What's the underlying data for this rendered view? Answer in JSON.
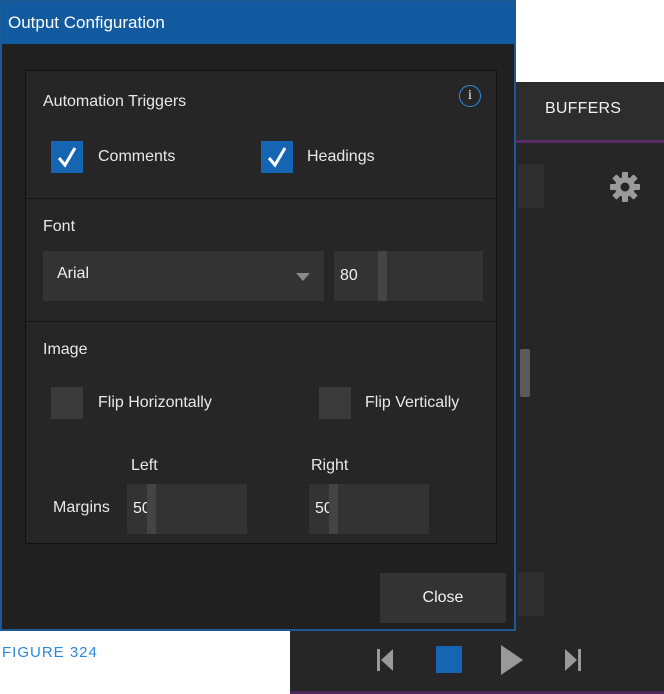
{
  "background_app": {
    "tab_buffers": "BUFFERS",
    "icons": [
      "gear-icon",
      "skip-back-icon",
      "stop-icon",
      "play-icon",
      "skip-forward-icon"
    ]
  },
  "dialog": {
    "title": "Output Configuration",
    "info_icon": "info-icon",
    "automation": {
      "heading": "Automation Triggers",
      "comments_label": "Comments",
      "comments_checked": true,
      "headings_label": "Headings",
      "headings_checked": true
    },
    "font": {
      "heading": "Font",
      "family": "Arial",
      "size": "80"
    },
    "image": {
      "heading": "Image",
      "flip_horizontal_label": "Flip Horizontally",
      "flip_horizontal_checked": false,
      "flip_vertical_label": "Flip Vertically",
      "flip_vertical_checked": false,
      "margins_label": "Margins",
      "left_label": "Left",
      "left_value": "50",
      "right_label": "Right",
      "right_value": "50"
    },
    "close_label": "Close"
  },
  "caption": "FIGURE 324",
  "colors": {
    "accent": "#125aa0",
    "checkbox_checked": "#1565b2",
    "caption": "#2a88d8"
  }
}
